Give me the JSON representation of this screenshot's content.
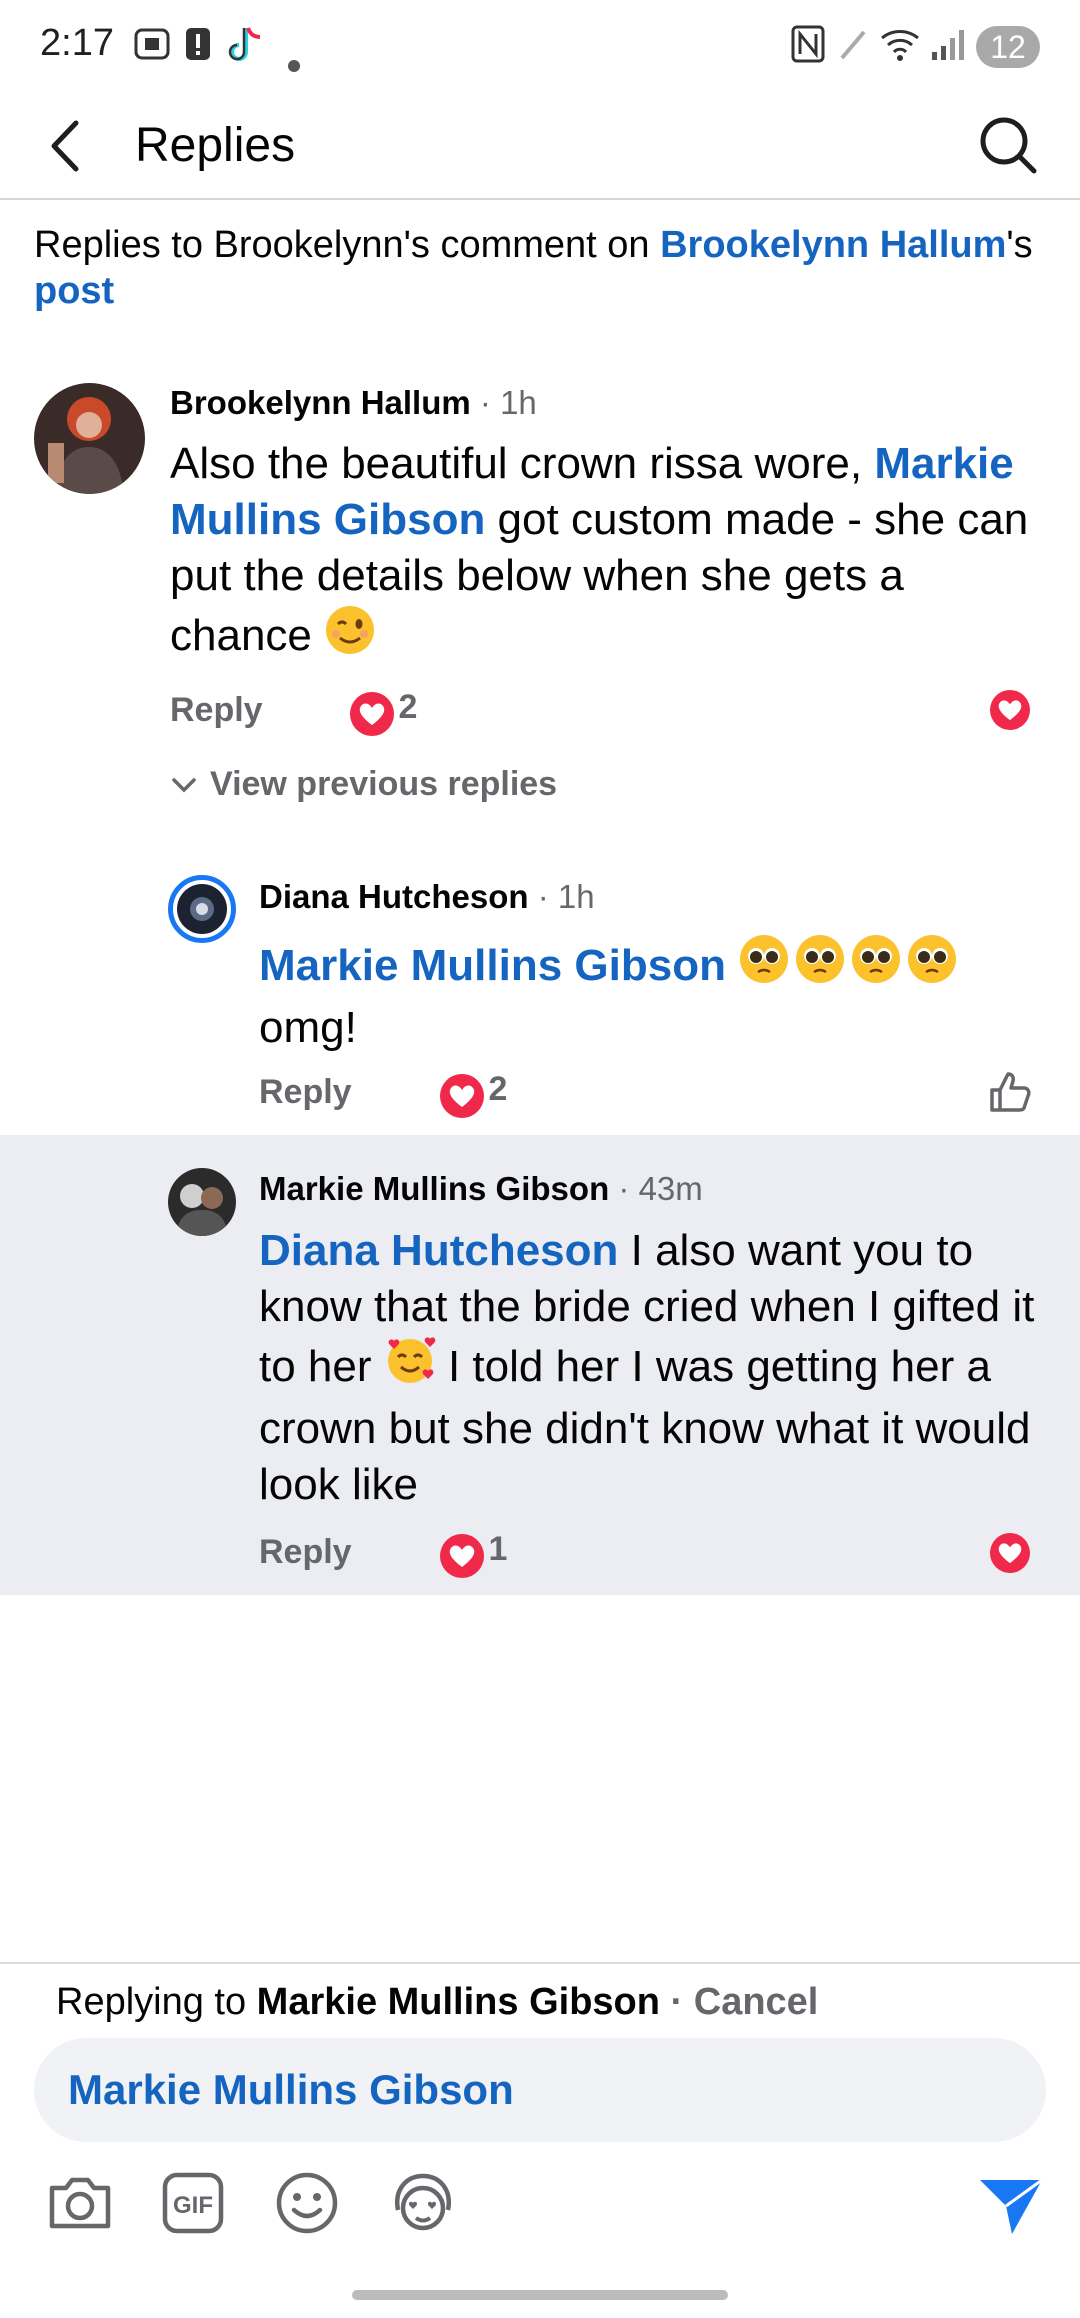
{
  "status_bar": {
    "time": "2:17",
    "battery": "12"
  },
  "header": {
    "title": "Replies"
  },
  "context": {
    "prefix": "Replies to Brookelynn's comment on ",
    "author_link": "Brookelynn Hallum",
    "suffix": "'s ",
    "post_link": "post"
  },
  "comments": [
    {
      "author": "Brookelynn Hallum",
      "time": "1h",
      "text_before": "Also the beautiful crown rissa wore, ",
      "mention": "Markie Mullins Gibson",
      "text_after": " got custom made - she can put the details below when she gets a chance",
      "reply_label": "Reply",
      "reaction_count": "2"
    },
    {
      "author": "Diana Hutcheson",
      "time": "1h",
      "mention": "Markie Mullins Gibson",
      "text_after": "omg!",
      "reply_label": "Reply",
      "reaction_count": "2"
    },
    {
      "author": "Markie Mullins Gibson",
      "time": "43m",
      "mention": "Diana Hutcheson",
      "text_part1": " I also want you to know that the bride cried when I gifted it to her ",
      "text_part2": " I told her I was getting her a crown but she didn't know what it would look like",
      "reply_label": "Reply",
      "reaction_count": "1"
    }
  ],
  "view_previous": "View previous replies",
  "composer": {
    "replying_prefix": "Replying to ",
    "replying_name": "Markie Mullins Gibson",
    "separator": " · ",
    "cancel": "Cancel",
    "input_value": "Markie Mullins Gibson"
  },
  "icons": {
    "back": "back-arrow-icon",
    "search": "search-icon",
    "camera": "camera-icon",
    "gif": "gif-icon",
    "emoji": "emoji-icon",
    "avatar_sticker": "avatar-sticker-icon",
    "send": "send-icon"
  },
  "colors": {
    "link": "#1565c0",
    "heart": "#f0284a",
    "highlight": "#ebedf2"
  }
}
